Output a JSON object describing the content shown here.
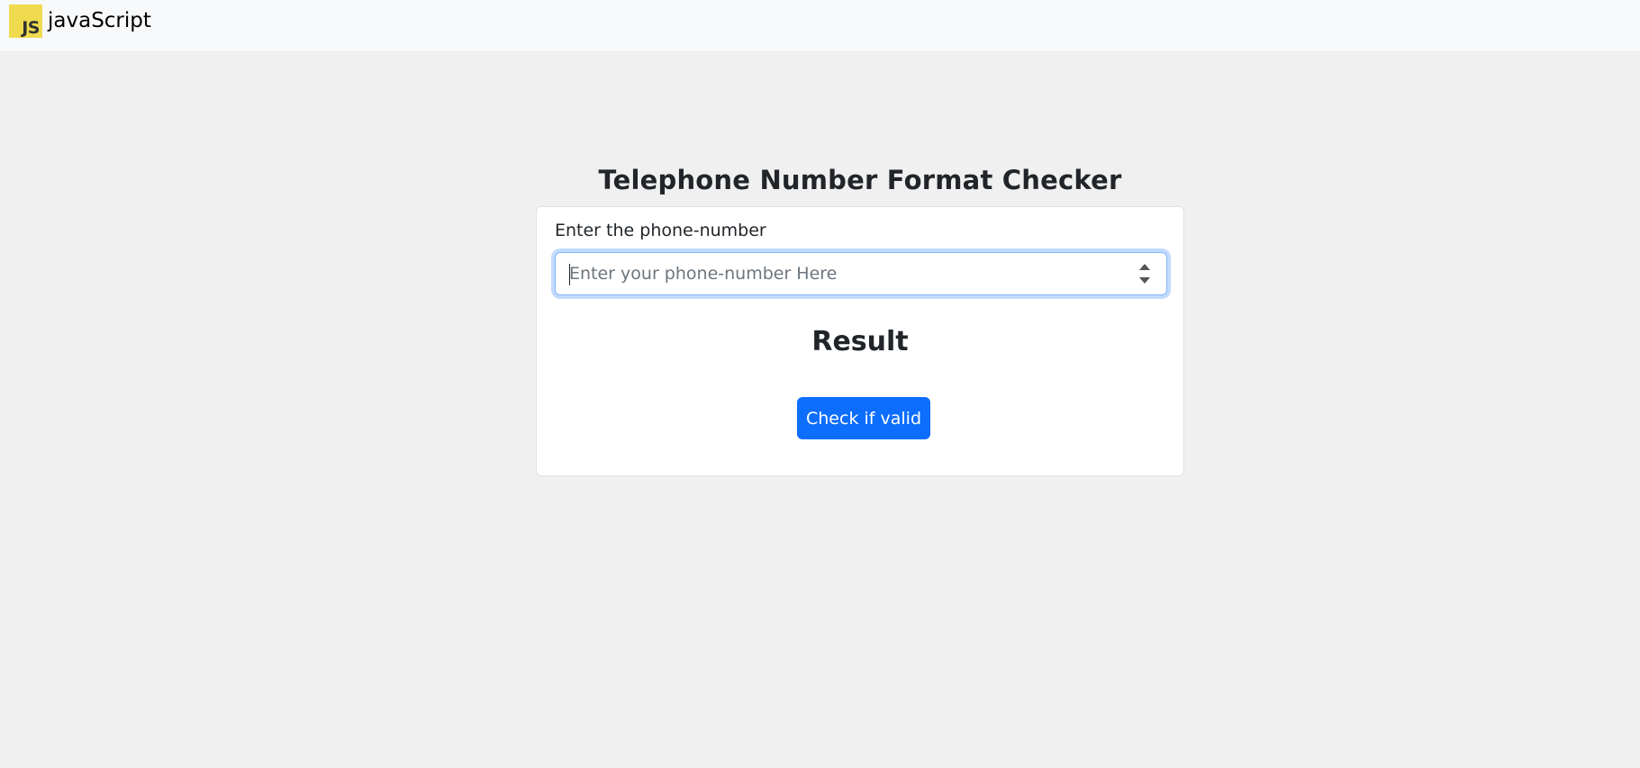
{
  "navbar": {
    "logo_text": "JS",
    "brand": "javaScript"
  },
  "page": {
    "title": "Telephone Number Format Checker"
  },
  "form": {
    "label": "Enter the phone-number",
    "input_value": "",
    "input_placeholder": "Enter your phone-number Here",
    "result_heading": "Result",
    "submit_label": "Check if valid"
  },
  "colors": {
    "logo_bg": "#f0db4f",
    "primary_button": "#0d6efd",
    "page_bg": "#f0f0f0",
    "navbar_bg": "#f8f9fa"
  },
  "icons": {
    "spinner": "number-spinner-icon"
  }
}
